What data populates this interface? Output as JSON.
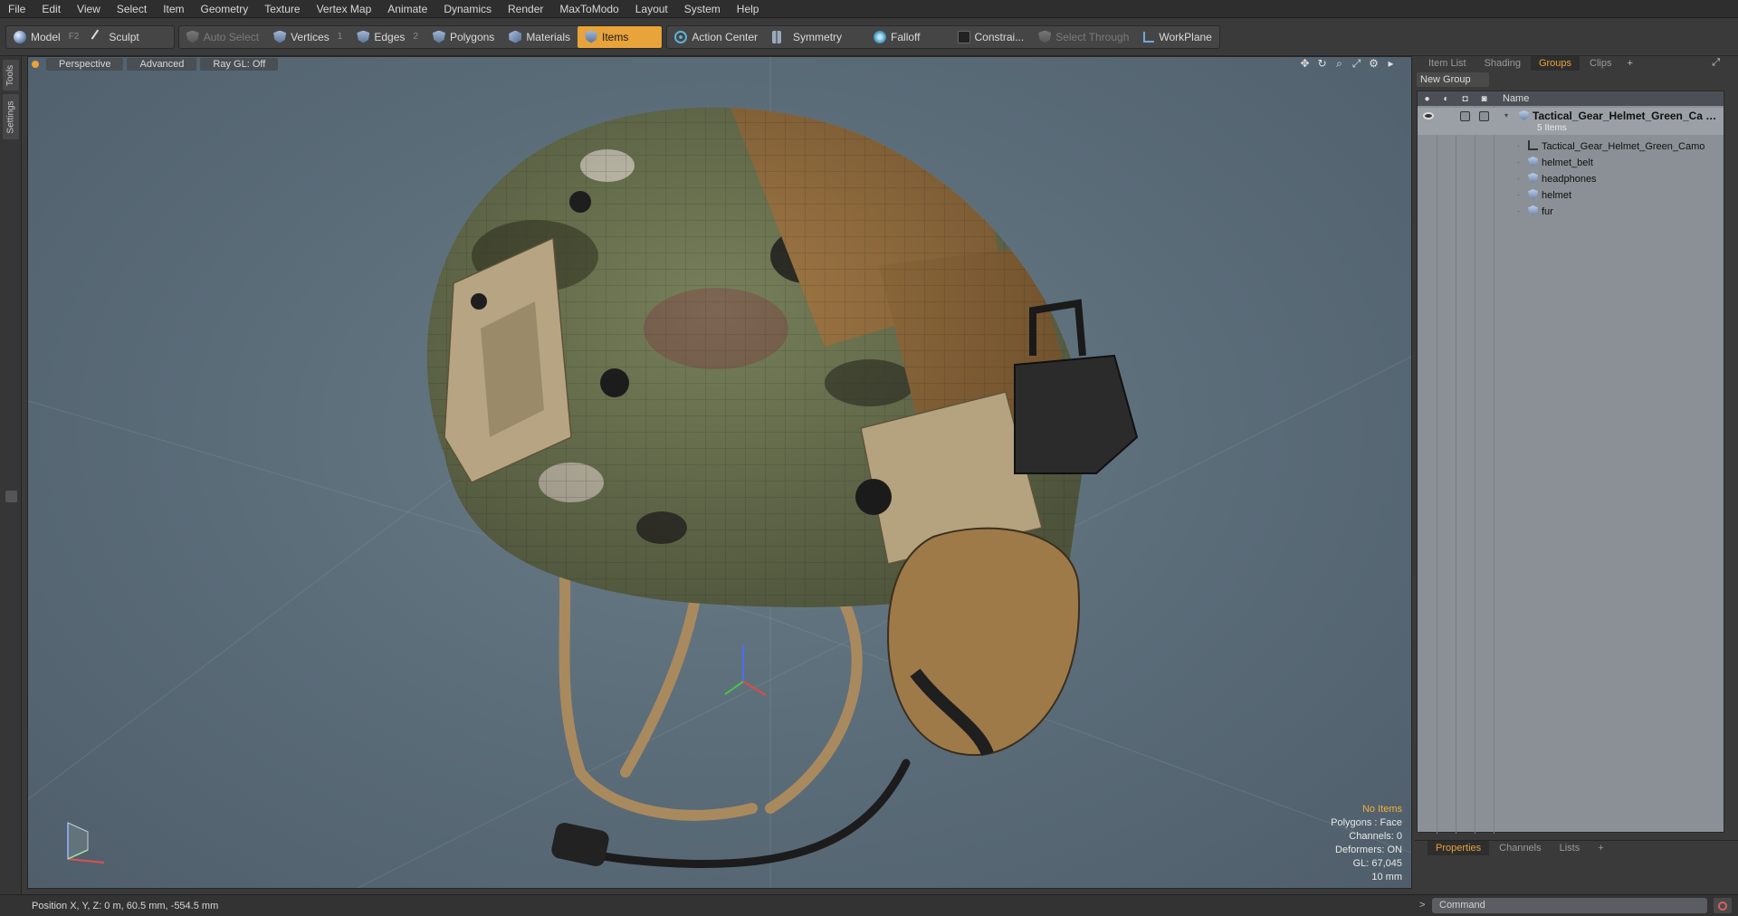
{
  "menu": [
    "File",
    "Edit",
    "View",
    "Select",
    "Item",
    "Geometry",
    "Texture",
    "Vertex Map",
    "Animate",
    "Dynamics",
    "Render",
    "MaxToModo",
    "Layout",
    "System",
    "Help"
  ],
  "toolbar": {
    "model": "Model",
    "model_key": "F2",
    "sculpt": "Sculpt",
    "auto_select": "Auto Select",
    "vertices": "Vertices",
    "vertices_key": "1",
    "edges": "Edges",
    "edges_key": "2",
    "polygons": "Polygons",
    "materials": "Materials",
    "items": "Items",
    "action_center": "Action Center",
    "symmetry": "Symmetry",
    "falloff": "Falloff",
    "constraints": "Constrai...",
    "select_through": "Select Through",
    "workplane": "WorkPlane"
  },
  "left_tabs": {
    "tools": "Tools",
    "settings": "Settings"
  },
  "viewport": {
    "view": "Perspective",
    "shading": "Advanced",
    "raygl": "Ray GL: Off",
    "hud": {
      "selection": "No Items",
      "polygons": "Polygons : Face",
      "channels": "Channels: 0",
      "deformers": "Deformers: ON",
      "gl": "GL: 67,045",
      "grid": "10 mm"
    }
  },
  "right_panel": {
    "tabs": [
      "Item List",
      "Shading",
      "Groups",
      "Clips"
    ],
    "active_tab": "Groups",
    "new_group": "New Group",
    "column_name": "Name",
    "group": {
      "name": "Tactical_Gear_Helmet_Green_Ca",
      "count": "5 Items"
    },
    "items": [
      "Tactical_Gear_Helmet_Green_Camo",
      "helmet_belt",
      "headphones",
      "helmet",
      "fur"
    ]
  },
  "bottom_panel": {
    "tabs": [
      "Properties",
      "Channels",
      "Lists"
    ],
    "active_tab": "Properties"
  },
  "status": {
    "position": "Position X, Y, Z:  0 m, 60.5 mm, -554.5 mm",
    "command_placeholder": "Command"
  },
  "colors": {
    "accent": "#e8a33a",
    "viewport_bg": "#5a6b78",
    "camo_green": "#6d7a4f",
    "coyote": "#a27a45"
  }
}
